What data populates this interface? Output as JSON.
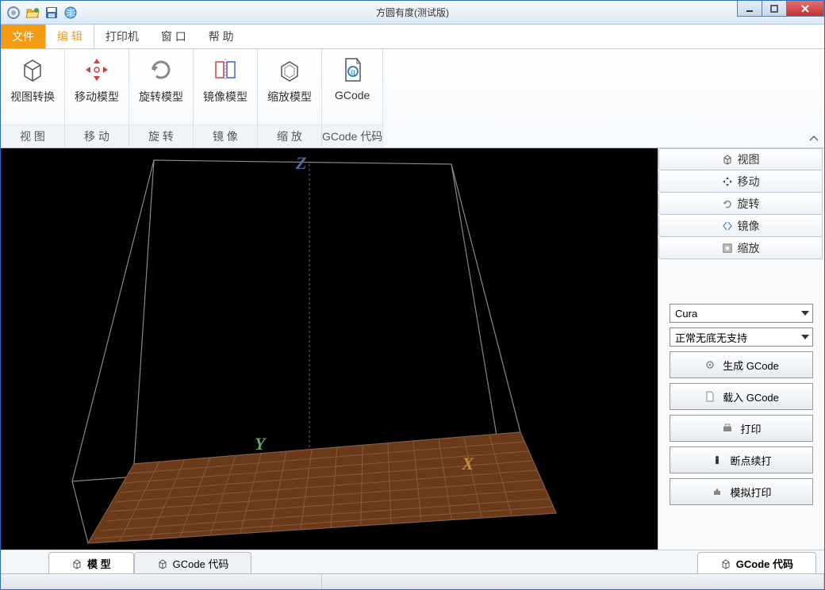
{
  "title": "方圆有度(测试版)",
  "menu": {
    "file": "文件",
    "edit": "编 辑",
    "printer": "打印机",
    "window": "窗 口",
    "help": "帮 助"
  },
  "ribbon": {
    "groups": [
      {
        "label": "视 图",
        "buttons": [
          {
            "name": "view-transform",
            "label": "视图转换"
          }
        ]
      },
      {
        "label": "移 动",
        "buttons": [
          {
            "name": "move-model",
            "label": "移动模型"
          }
        ]
      },
      {
        "label": "旋 转",
        "buttons": [
          {
            "name": "rotate-model",
            "label": "旋转模型"
          }
        ]
      },
      {
        "label": "镜 像",
        "buttons": [
          {
            "name": "mirror-model",
            "label": "镜像模型"
          }
        ]
      },
      {
        "label": "缩 放",
        "buttons": [
          {
            "name": "scale-model",
            "label": "缩放模型"
          }
        ]
      },
      {
        "label": "GCode 代码",
        "buttons": [
          {
            "name": "gcode",
            "label": "GCode"
          }
        ]
      }
    ]
  },
  "axes": {
    "x": "X",
    "y": "Y",
    "z": "Z"
  },
  "accordion": [
    {
      "name": "view",
      "label": "视图"
    },
    {
      "name": "move",
      "label": "移动"
    },
    {
      "name": "rotate",
      "label": "旋转"
    },
    {
      "name": "mirror",
      "label": "镜像"
    },
    {
      "name": "scale",
      "label": "缩放"
    }
  ],
  "side": {
    "slicer": "Cura",
    "profile": "正常无底无支持",
    "buttons": {
      "generate": "生成 GCode",
      "load": "载入 GCode",
      "print": "打印",
      "resume": "断点续打",
      "simulate": "模拟打印"
    }
  },
  "bottomTabs": {
    "model": "模 型",
    "gcode": "GCode 代码",
    "right": "GCode 代码"
  }
}
